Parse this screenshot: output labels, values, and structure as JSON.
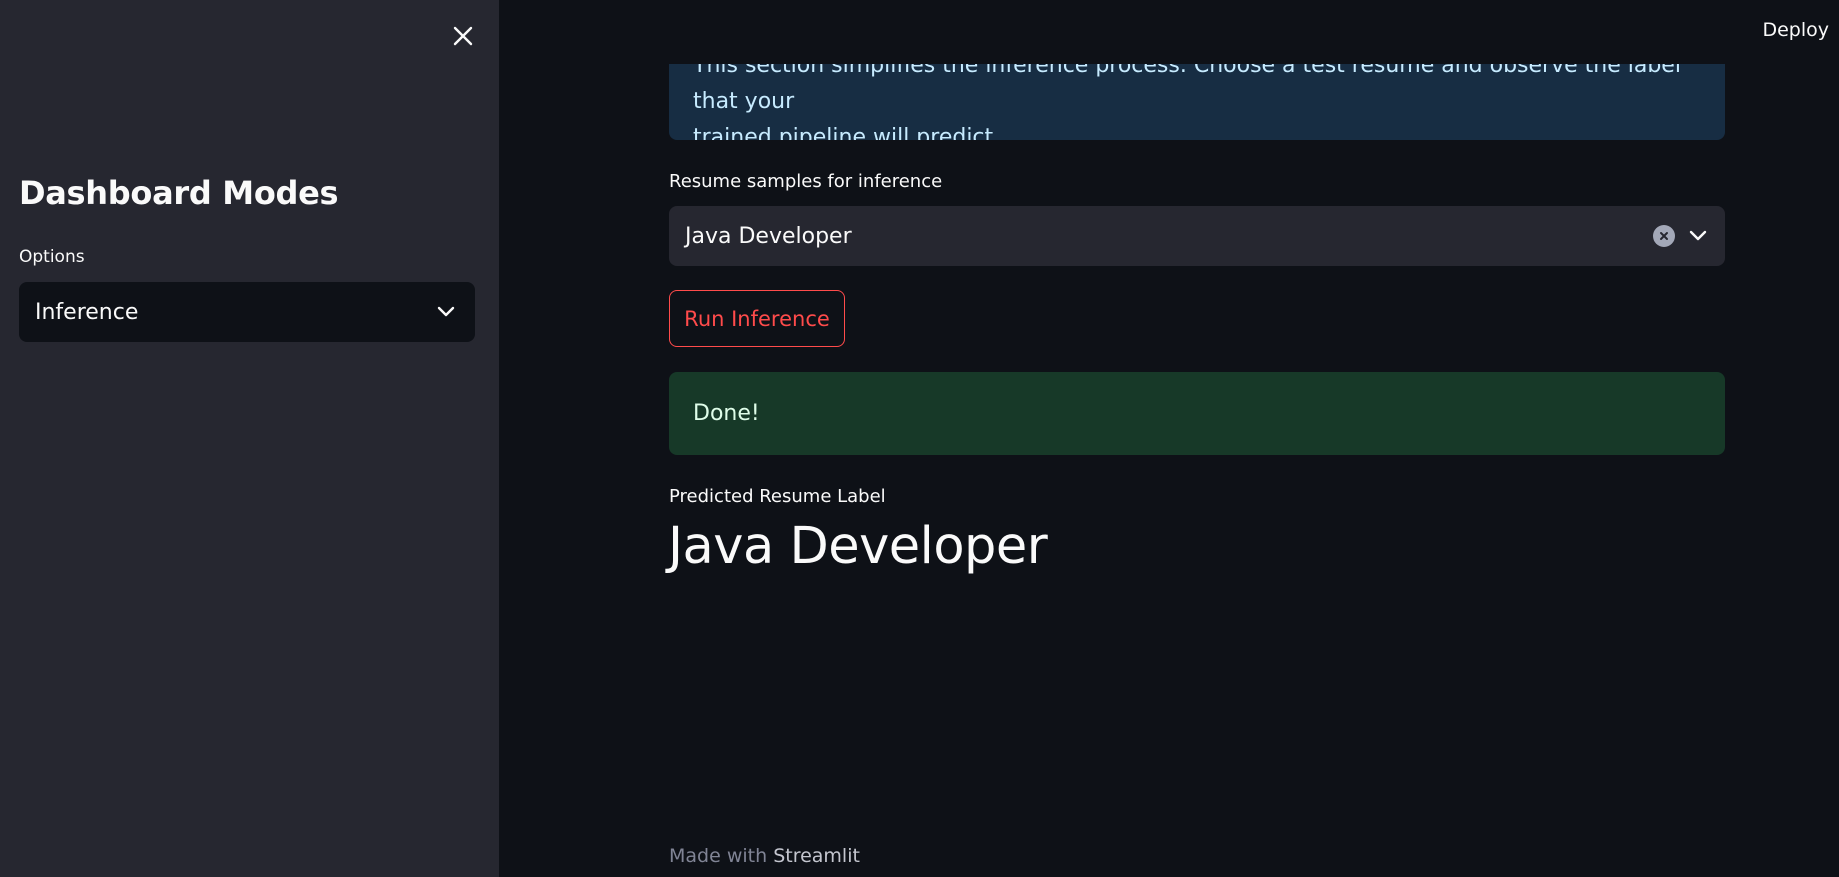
{
  "sidebar": {
    "title": "Dashboard Modes",
    "options_label": "Options",
    "mode_select": {
      "value": "Inference"
    }
  },
  "header": {
    "deploy_label": "Deploy"
  },
  "main": {
    "info_text_line1": "This section simplifies the inference process. Choose a test resume and observe the label that your",
    "info_text_line2": "trained pipeline will predict.",
    "sample_select_label": "Resume samples for inference",
    "sample_select_value": "Java Developer",
    "run_button_label": "Run Inference",
    "success_message": "Done!",
    "metric_label": "Predicted Resume Label",
    "metric_value": "Java Developer"
  },
  "footer": {
    "prefix": "Made with",
    "brand": "Streamlit"
  },
  "colors": {
    "background": "#0e1117",
    "sidebar": "#262730",
    "accent": "#ff4b4b",
    "info_bg": "#172d43",
    "success_bg": "#173928"
  },
  "icons": [
    "close-icon",
    "chevron-down-icon",
    "clear-icon"
  ]
}
